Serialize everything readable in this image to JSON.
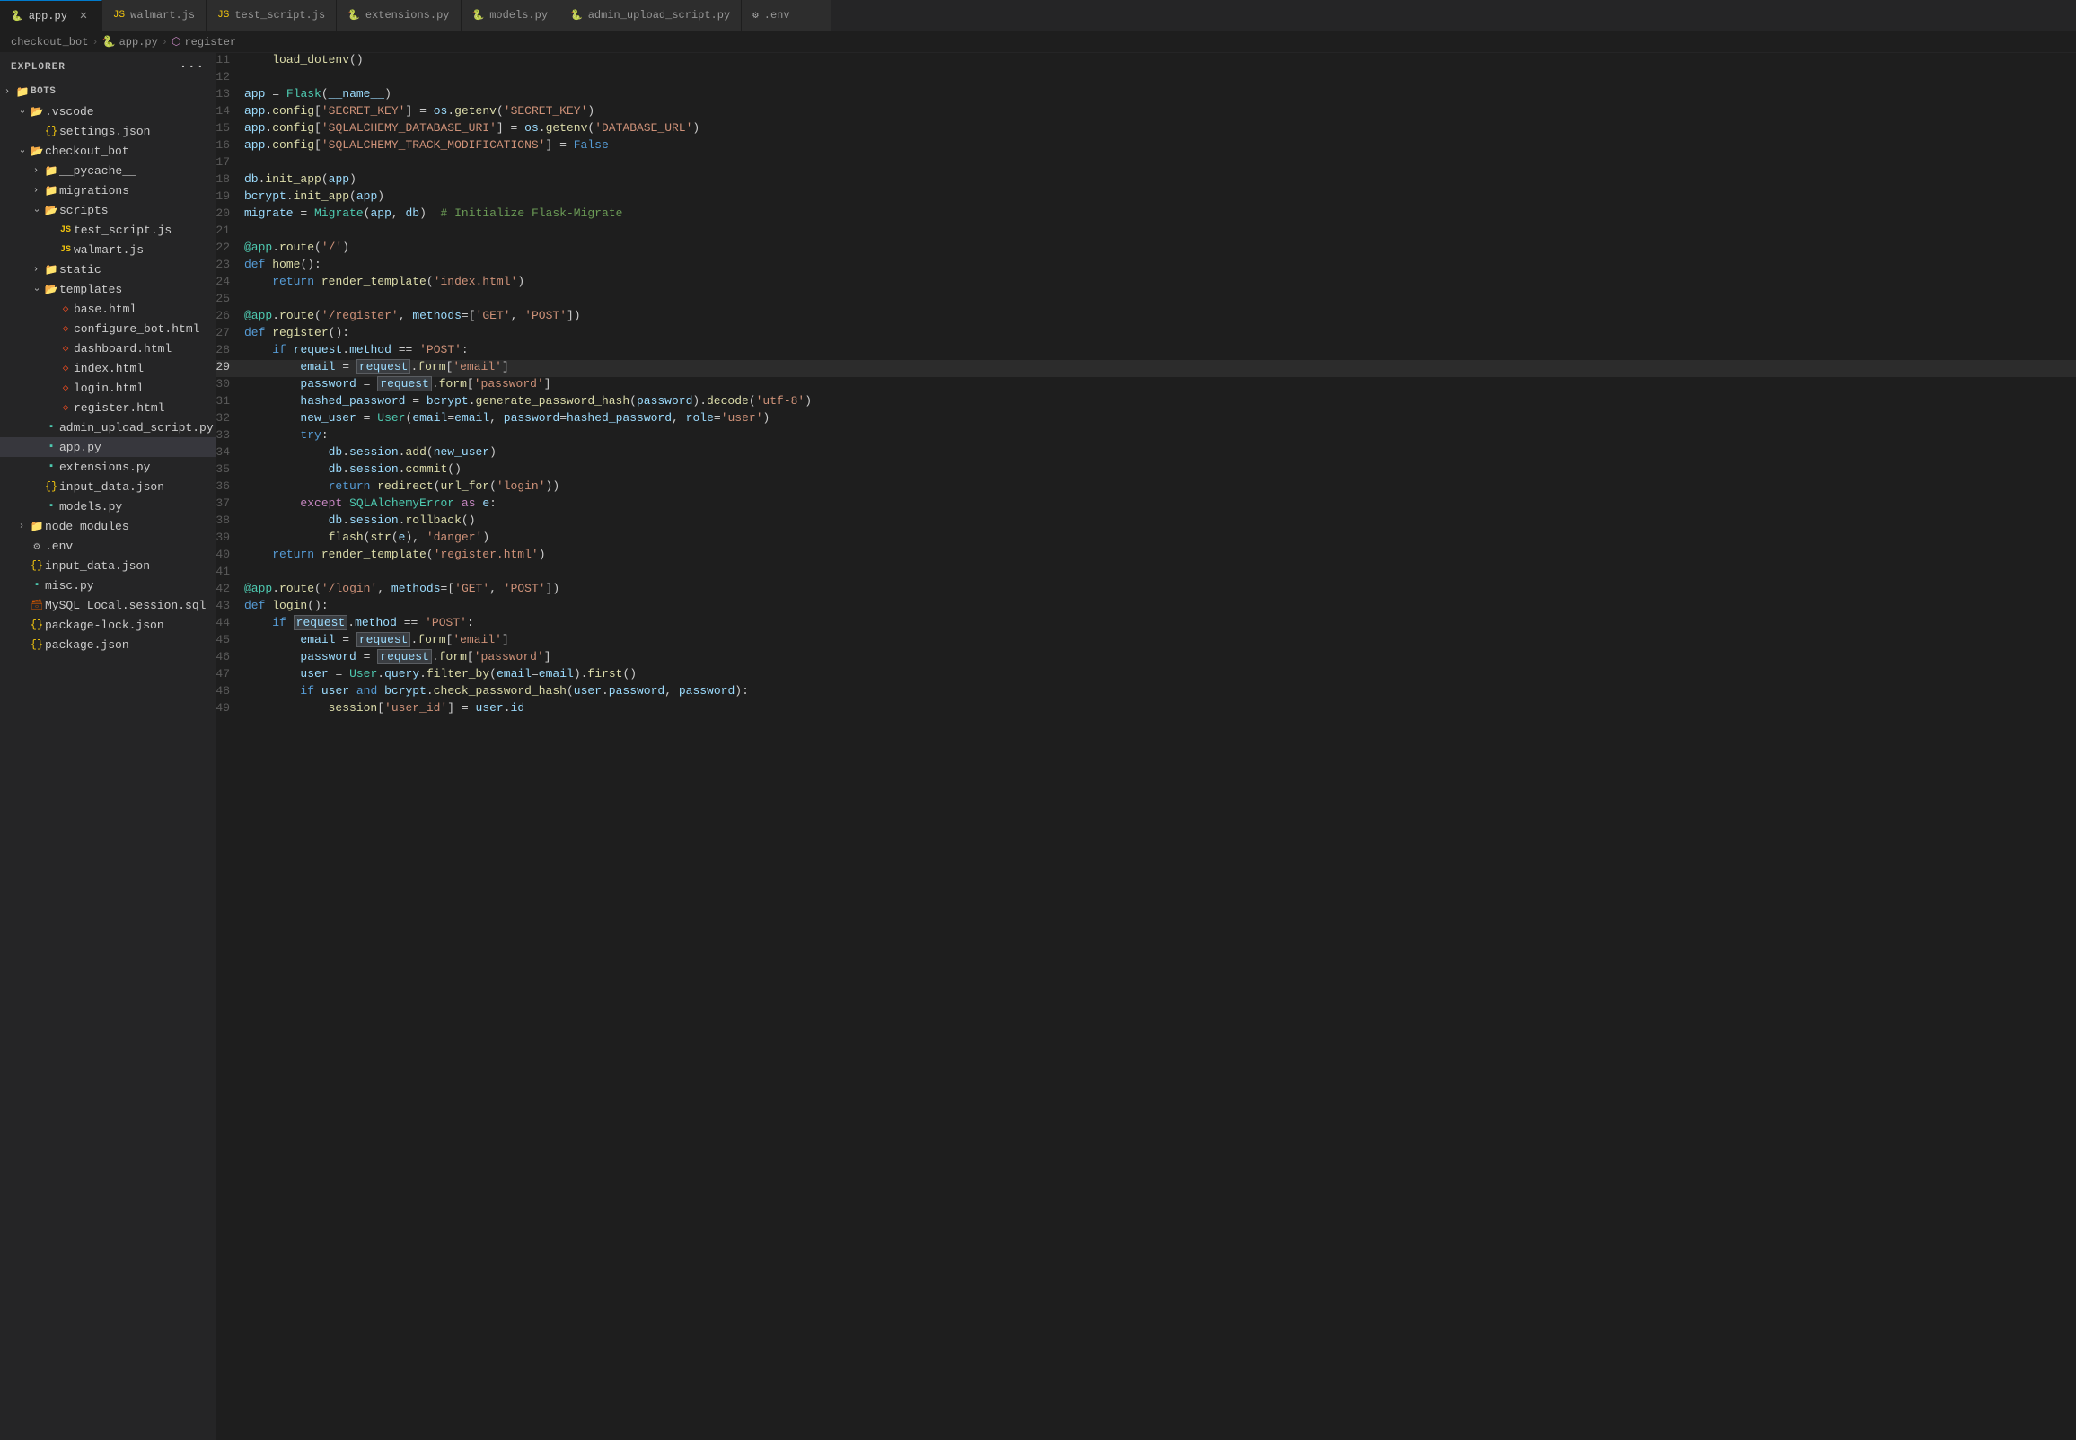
{
  "tabs": [
    {
      "id": "app-py",
      "label": "app.py",
      "icon": "py",
      "active": true,
      "modified": false
    },
    {
      "id": "walmart-js",
      "label": "walmart.js",
      "icon": "js",
      "active": false,
      "modified": false
    },
    {
      "id": "test-script-js",
      "label": "test_script.js",
      "icon": "js",
      "active": false,
      "modified": false
    },
    {
      "id": "extensions-py",
      "label": "extensions.py",
      "icon": "py",
      "active": false,
      "modified": false
    },
    {
      "id": "models-py",
      "label": "models.py",
      "icon": "py",
      "active": false,
      "modified": false
    },
    {
      "id": "admin-upload-script-py",
      "label": "admin_upload_script.py",
      "icon": "py",
      "active": false,
      "modified": false
    },
    {
      "id": "env",
      "label": ".env",
      "icon": "env",
      "active": false,
      "modified": false
    }
  ],
  "breadcrumb": {
    "parts": [
      "checkout_bot",
      "app.py",
      "register"
    ]
  },
  "sidebar": {
    "title": "EXPLORER",
    "root": "BOTS"
  },
  "tree": [
    {
      "level": 0,
      "name": ".vscode",
      "type": "folder",
      "open": true
    },
    {
      "level": 1,
      "name": "settings.json",
      "type": "json"
    },
    {
      "level": 0,
      "name": "checkout_bot",
      "type": "folder",
      "open": true
    },
    {
      "level": 1,
      "name": "__pycache__",
      "type": "folder",
      "open": false
    },
    {
      "level": 1,
      "name": "migrations",
      "type": "folder",
      "open": false
    },
    {
      "level": 1,
      "name": "scripts",
      "type": "folder",
      "open": true
    },
    {
      "level": 2,
      "name": "test_script.js",
      "type": "js"
    },
    {
      "level": 2,
      "name": "walmart.js",
      "type": "js"
    },
    {
      "level": 1,
      "name": "static",
      "type": "folder",
      "open": false
    },
    {
      "level": 1,
      "name": "templates",
      "type": "folder",
      "open": true
    },
    {
      "level": 2,
      "name": "base.html",
      "type": "html"
    },
    {
      "level": 2,
      "name": "configure_bot.html",
      "type": "html"
    },
    {
      "level": 2,
      "name": "dashboard.html",
      "type": "html"
    },
    {
      "level": 2,
      "name": "index.html",
      "type": "html"
    },
    {
      "level": 2,
      "name": "login.html",
      "type": "html"
    },
    {
      "level": 2,
      "name": "register.html",
      "type": "html"
    },
    {
      "level": 1,
      "name": "admin_upload_script.py",
      "type": "py"
    },
    {
      "level": 1,
      "name": "app.py",
      "type": "py",
      "selected": true
    },
    {
      "level": 1,
      "name": "extensions.py",
      "type": "py"
    },
    {
      "level": 1,
      "name": "input_data.json",
      "type": "json"
    },
    {
      "level": 1,
      "name": "models.py",
      "type": "py"
    },
    {
      "level": 0,
      "name": "node_modules",
      "type": "folder",
      "open": false
    },
    {
      "level": 0,
      "name": ".env",
      "type": "env"
    },
    {
      "level": 0,
      "name": "input_data.json",
      "type": "json"
    },
    {
      "level": 0,
      "name": "misc.py",
      "type": "py"
    },
    {
      "level": 0,
      "name": "MySQL Local.session.sql",
      "type": "sql"
    },
    {
      "level": 0,
      "name": "package-lock.json",
      "type": "json"
    },
    {
      "level": 0,
      "name": "package.json",
      "type": "json"
    }
  ],
  "active_line": 29
}
